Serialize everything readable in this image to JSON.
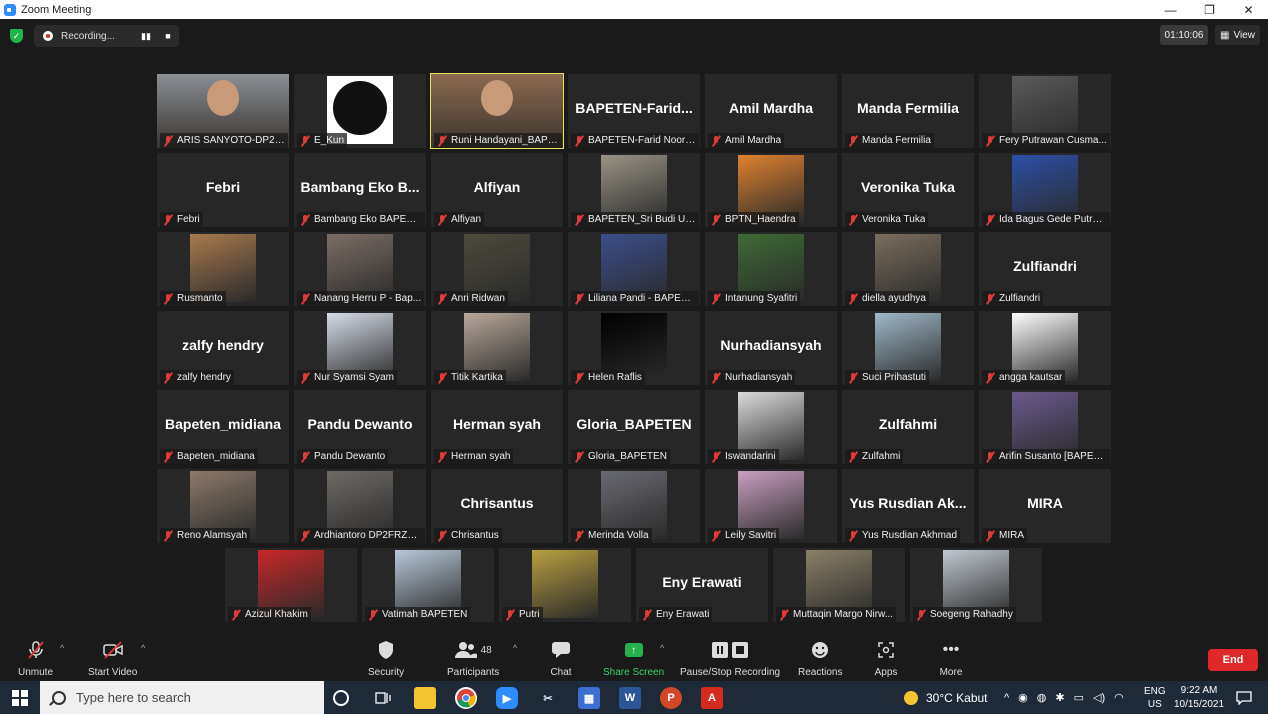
{
  "window": {
    "title": "Zoom Meeting",
    "minimize": "—",
    "maximize": "❐",
    "close": "✕"
  },
  "meeting": {
    "recording_label": "Recording...",
    "timer": "01:10:06",
    "view_label": "View"
  },
  "tiles": [
    {
      "display": "",
      "label": "ARIS SANYOTO-DP2FRZR...",
      "kind": "video",
      "color": "#8a8f94"
    },
    {
      "display": "",
      "label": "E_Kun",
      "kind": "logo",
      "color": "#ffffff"
    },
    {
      "display": "",
      "label": "Runi Handayani_BAPETEN",
      "kind": "video",
      "color": "#8c6a4e",
      "active": true
    },
    {
      "display": "BAPETEN-Farid...",
      "label": "BAPETEN-Farid Noor J...",
      "kind": "name"
    },
    {
      "display": "Amil Mardha",
      "label": "Amil Mardha",
      "kind": "name"
    },
    {
      "display": "Manda Fermilia",
      "label": "Manda Fermilia",
      "kind": "name"
    },
    {
      "display": "",
      "label": "Fery Putrawan Cusma...",
      "kind": "photo",
      "color": "#5a5a5a"
    },
    {
      "display": "Febri",
      "label": "Febri",
      "kind": "name"
    },
    {
      "display": "Bambang Eko B...",
      "label": "Bambang Eko BAPETEN",
      "kind": "name"
    },
    {
      "display": "Alfiyan",
      "label": "Alfiyan",
      "kind": "name"
    },
    {
      "display": "",
      "label": "BAPETEN_Sri Budi Uta...",
      "kind": "photo",
      "color": "#9a9486"
    },
    {
      "display": "",
      "label": "BPTN_Haendra",
      "kind": "photo",
      "color": "#e0822f"
    },
    {
      "display": "Veronika Tuka",
      "label": "Veronika Tuka",
      "kind": "name"
    },
    {
      "display": "",
      "label": "Ida Bagus Gede Putra ...",
      "kind": "photo",
      "color": "#2c4fa8"
    },
    {
      "display": "",
      "label": "Rusmanto",
      "kind": "photo",
      "color": "#a87a4c"
    },
    {
      "display": "",
      "label": "Nanang Herru P - Bap...",
      "kind": "photo",
      "color": "#7c6e66"
    },
    {
      "display": "",
      "label": "Anri Ridwan",
      "kind": "photo",
      "color": "#4d4a3c"
    },
    {
      "display": "",
      "label": "Liliana Pandi - BAPETEN",
      "kind": "photo",
      "color": "#3c4f8c"
    },
    {
      "display": "",
      "label": "Intanung Syafitri",
      "kind": "photo",
      "color": "#3e6b35"
    },
    {
      "display": "",
      "label": "diella ayudhya",
      "kind": "photo",
      "color": "#7a6e5e"
    },
    {
      "display": "Zulfiandri",
      "label": "Zulfiandri",
      "kind": "name"
    },
    {
      "display": "zalfy hendry",
      "label": "zalfy hendry",
      "kind": "name"
    },
    {
      "display": "",
      "label": "Nur Syamsi Syam",
      "kind": "photo",
      "color": "#d6dce8"
    },
    {
      "display": "",
      "label": "Titik Kartika",
      "kind": "photo",
      "color": "#b8a89a"
    },
    {
      "display": "",
      "label": "Helen Raflis",
      "kind": "photo",
      "color": "#000000"
    },
    {
      "display": "Nurhadiansyah",
      "label": "Nurhadiansyah",
      "kind": "name"
    },
    {
      "display": "",
      "label": "Suci Prihastuti",
      "kind": "photo",
      "color": "#9fb8c8"
    },
    {
      "display": "",
      "label": "angga kautsar",
      "kind": "photo",
      "color": "#ffffff"
    },
    {
      "display": "Bapeten_midiana",
      "label": "Bapeten_midiana",
      "kind": "name"
    },
    {
      "display": "Pandu Dewanto",
      "label": "Pandu Dewanto",
      "kind": "name"
    },
    {
      "display": "Herman syah",
      "label": "Herman syah",
      "kind": "name"
    },
    {
      "display": "Gloria_BAPETEN",
      "label": "Gloria_BAPETEN",
      "kind": "name"
    },
    {
      "display": "",
      "label": "Iswandarini",
      "kind": "photo",
      "color": "#dcdcdc"
    },
    {
      "display": "Zulfahmi",
      "label": "Zulfahmi",
      "kind": "name"
    },
    {
      "display": "",
      "label": "Arifin Susanto [BAPETE...",
      "kind": "photo",
      "color": "#6a5a8c"
    },
    {
      "display": "",
      "label": "Reno Alamsyah",
      "kind": "photo",
      "color": "#8c7a6a"
    },
    {
      "display": "",
      "label": "Ardhiantoro DP2FRZR...",
      "kind": "photo",
      "color": "#6e6a66"
    },
    {
      "display": "Chrisantus",
      "label": "Chrisantus",
      "kind": "name"
    },
    {
      "display": "",
      "label": "Merinda Volla",
      "kind": "photo",
      "color": "#6a6a72"
    },
    {
      "display": "",
      "label": "Leily Savitri",
      "kind": "photo",
      "color": "#c8a0c0"
    },
    {
      "display": "Yus Rusdian Ak...",
      "label": "Yus Rusdian Akhmad",
      "kind": "name"
    },
    {
      "display": "MIRA",
      "label": "MIRA",
      "kind": "name"
    },
    {
      "display": "",
      "label": "Azizul Khakim",
      "kind": "photo",
      "color": "#c82828"
    },
    {
      "display": "",
      "label": "Vatimah BAPETEN",
      "kind": "photo",
      "color": "#b8c8d8"
    },
    {
      "display": "",
      "label": "Putri",
      "kind": "photo",
      "color": "#b8a040"
    },
    {
      "display": "Eny Erawati",
      "label": "Eny Erawati",
      "kind": "name"
    },
    {
      "display": "",
      "label": "Muttaqin Margo Nirw...",
      "kind": "photo",
      "color": "#8a8068"
    },
    {
      "display": "",
      "label": "Soegeng Rahadhy",
      "kind": "photo",
      "color": "#c0c8d0"
    }
  ],
  "toolbar": {
    "unmute": "Unmute",
    "start_video": "Start Video",
    "security": "Security",
    "participants": "Participants",
    "participants_count": "48",
    "chat": "Chat",
    "share_screen": "Share Screen",
    "pause_stop_recording": "Pause/Stop Recording",
    "reactions": "Reactions",
    "apps": "Apps",
    "more": "More",
    "end": "End"
  },
  "taskbar": {
    "search_placeholder": "Type here to search",
    "weather": "30°C  Kabut",
    "language": "ENG",
    "region": "US",
    "time": "9:22 AM",
    "date": "10/15/2021"
  }
}
